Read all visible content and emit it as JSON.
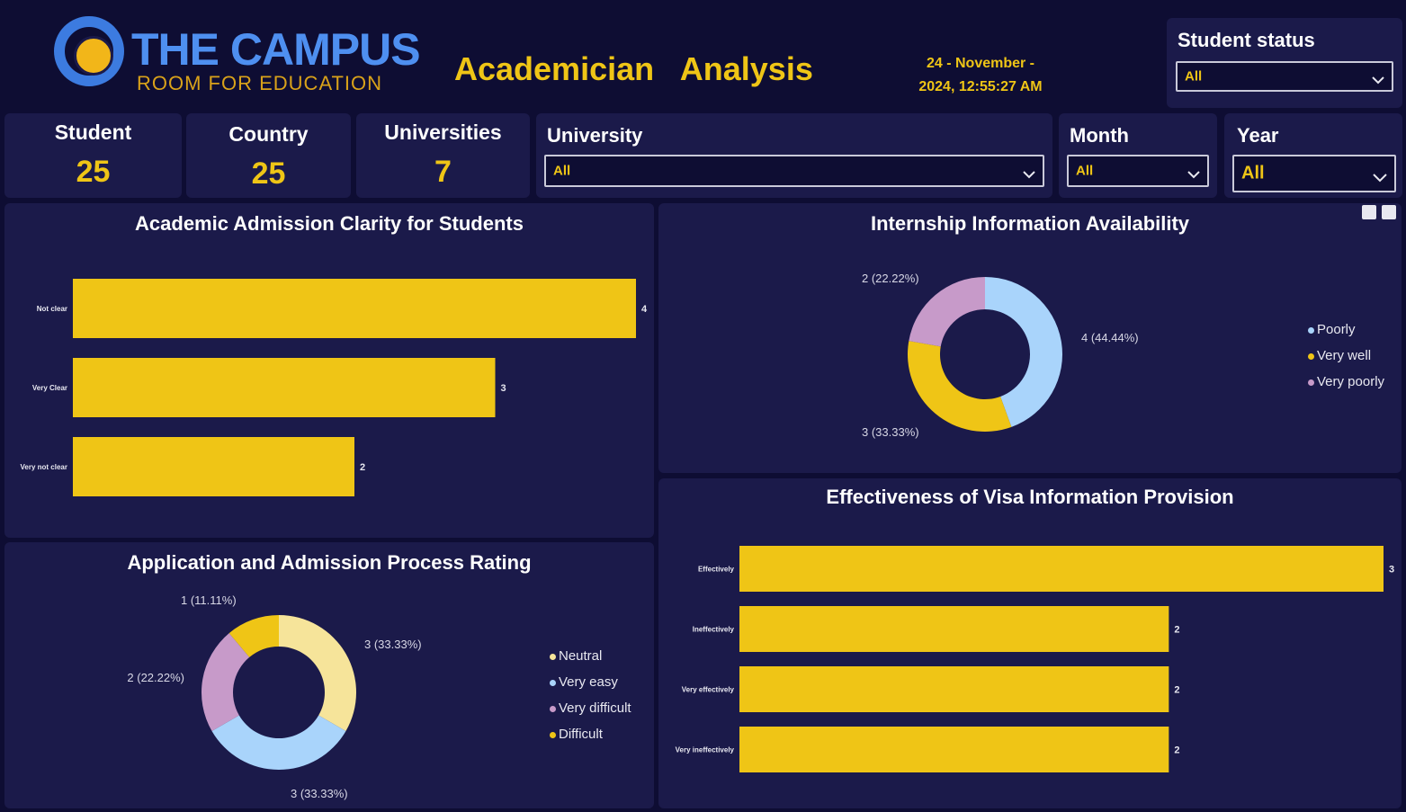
{
  "brand": {
    "name": "THE CAMPUS",
    "tagline": "ROOM FOR EDUCATION"
  },
  "header": {
    "title": "Academician   Analysis",
    "datetime_line1": "24 - November -",
    "datetime_line2": "2024, 12:55:27 AM"
  },
  "slicers": {
    "student_status": {
      "label": "Student status",
      "value": "All"
    },
    "university": {
      "label": "University",
      "value": "All"
    },
    "month": {
      "label": "Month",
      "value": "All"
    },
    "year": {
      "label": "Year",
      "value": "All"
    }
  },
  "kpis": [
    {
      "label": "Student",
      "value": "25"
    },
    {
      "label": "Country",
      "value": "25"
    },
    {
      "label": "Universities",
      "value": "7"
    }
  ],
  "colors": {
    "background": "#0e0d33",
    "card": "#1b1a4a",
    "accent": "#efc516",
    "bar": "#efc516",
    "light_blue": "#a9d4fb",
    "pink": "#c79ac9",
    "pale_yellow": "#f6e49a"
  },
  "chart_data": [
    {
      "id": "admission_clarity",
      "type": "bar",
      "orientation": "horizontal",
      "title": "Academic Admission Clarity for Students",
      "categories": [
        "Not clear",
        "Very Clear",
        "Very not clear"
      ],
      "values": [
        4,
        3,
        2
      ],
      "xlim": [
        0,
        4
      ]
    },
    {
      "id": "internship_info",
      "type": "pie",
      "donut": true,
      "title": "Internship Information Availability",
      "categories": [
        "Poorly",
        "Very well",
        "Very poorly"
      ],
      "values": [
        4,
        3,
        2
      ],
      "labels": [
        "4 (44.44%)",
        "3 (33.33%)",
        "2 (22.22%)"
      ],
      "colors": [
        "#a9d4fb",
        "#efc516",
        "#c79ac9"
      ],
      "legend": "right"
    },
    {
      "id": "application_rating",
      "type": "pie",
      "donut": true,
      "title": "Application and Admission Process Rating",
      "categories": [
        "Neutral",
        "Very easy",
        "Very difficult",
        "Difficult"
      ],
      "values": [
        3,
        3,
        2,
        1
      ],
      "labels": [
        "3 (33.33%)",
        "3 (33.33%)",
        "2 (22.22%)",
        "1 (11.11%)"
      ],
      "colors": [
        "#f6e49a",
        "#a9d4fb",
        "#c79ac9",
        "#efc516"
      ],
      "legend": "right"
    },
    {
      "id": "visa_info",
      "type": "bar",
      "orientation": "horizontal",
      "title": "Effectiveness of Visa Information Provision",
      "categories": [
        "Effectively",
        "Ineffectively",
        "Very effectively",
        "Very ineffectively"
      ],
      "values": [
        3,
        2,
        2,
        2
      ],
      "xlim": [
        0,
        3
      ]
    }
  ]
}
